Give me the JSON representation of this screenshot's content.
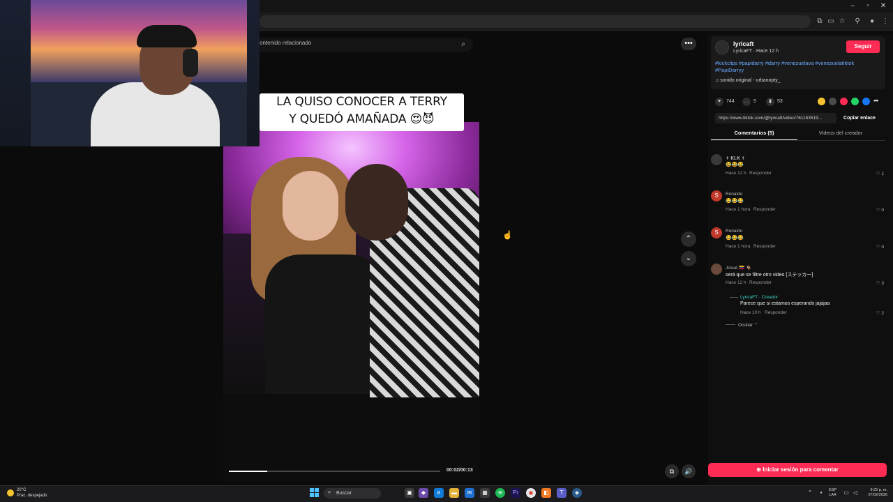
{
  "window": {
    "minimize": "–",
    "maximize": "▫",
    "close": "✕"
  },
  "search": {
    "placeholder": "ontenido relacionado",
    "icon": "search-icon"
  },
  "video": {
    "caption_line1": "LA QUISO CONOCER A TERRY",
    "caption_line2": "Y QUEDÓ AMAÑADA 😍😈",
    "timecode": "00:02/00:13",
    "progress": 0.18
  },
  "author": {
    "name": "lyricaft",
    "meta": "LyricaFT · Hace 12 h",
    "follow_label": "Seguir",
    "hashtags": "#kickclips #papidarry #darry #venezuelava #venezuelatiktok #PapiDarryy",
    "sound": "♫  sonido original - urbanopty_"
  },
  "stats": {
    "likes": "744",
    "comments": "5",
    "saves": "53"
  },
  "share": {
    "link": "https://www.tiktok.com/@lyricaft/video/761153519...",
    "copy_label": "Copiar enlace",
    "colors": [
      "#f4c430",
      "#4b4b4b",
      "#fe2c55",
      "#25d366",
      "#1877f2"
    ]
  },
  "tabs": {
    "comments": "Comentarios (5)",
    "creator_videos": "Videos del creador"
  },
  "comments": [
    {
      "user": "✝ 𝐊𝐋𝐊 ✝",
      "text": "😂😂😂",
      "time": "Hace 12 h",
      "reply": "Responder",
      "likes": "1",
      "avatar_color": "#3a3a3a",
      "initial": ""
    },
    {
      "user": "Ronaldo",
      "text": "😂😂😂",
      "time": "Hace 1 hora",
      "reply": "Responder",
      "likes": "0",
      "avatar_color": "#c0392b",
      "initial": "S"
    },
    {
      "user": "Ronaldo",
      "text": "😂😂😂",
      "time": "Hace 1 hora",
      "reply": "Responder",
      "likes": "0",
      "avatar_color": "#c0392b",
      "initial": "S"
    },
    {
      "user": "Josué 🇻🇪 🐐",
      "text": "será que se filtre otro video [ステッカー]",
      "time": "Hace 12 h",
      "reply": "Responder",
      "likes": "3",
      "avatar_color": "#6a4a3a",
      "initial": ""
    }
  ],
  "reply": {
    "user": "LyricaFT · Creador",
    "text": "Parece que si estamos esperando jajajaa",
    "time": "Hace 10 h",
    "reply": "Responder",
    "likes": "2",
    "hide": "Ocultar ⌃"
  },
  "login_label": "⊕ Iniciar sesión para comentar",
  "taskbar": {
    "weather_temp": "20°C",
    "weather_desc": "Prac. despejado",
    "search": "Buscar",
    "lang1": "ESP",
    "lang2": "LAA",
    "time": "9:22 p. m.",
    "date": "27/02/2026"
  }
}
